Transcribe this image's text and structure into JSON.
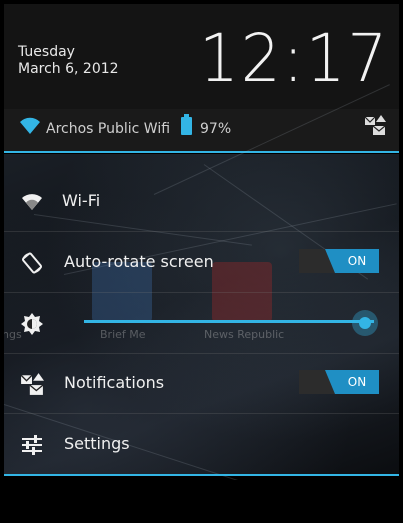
{
  "header": {
    "day": "Tuesday",
    "date": "March 6, 2012",
    "time": "12:17"
  },
  "status": {
    "network": "Archos Public Wifi",
    "battery": "97%"
  },
  "quick_settings": {
    "wifi_label": "Wi-Fi",
    "autorotate_label": "Auto-rotate screen",
    "autorotate_state": "ON",
    "brightness_level": 0.97,
    "notifications_label": "Notifications",
    "notifications_state": "ON",
    "settings_label": "Settings"
  },
  "background_apps": {
    "app1": "Brief Me",
    "app2": "News Republic",
    "app3": "ngs"
  },
  "colors": {
    "accent": "#33b5e5",
    "toggle_on": "#1f8fc4"
  }
}
